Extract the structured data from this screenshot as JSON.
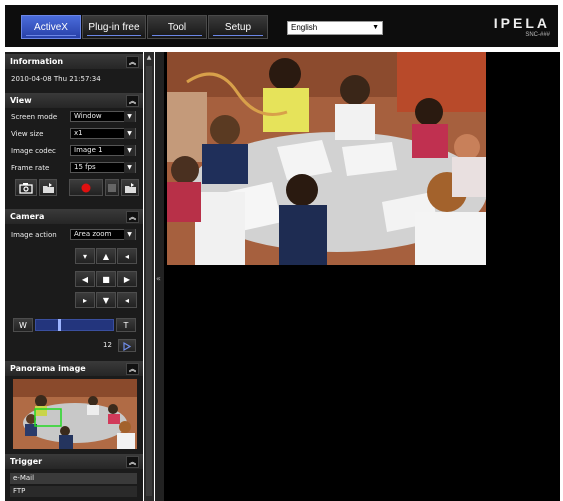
{
  "tabs": [
    {
      "label": "ActiveX",
      "active": true
    },
    {
      "label": "Plug-in free",
      "active": false
    },
    {
      "label": "Tool",
      "active": false
    },
    {
      "label": "Setup",
      "active": false
    }
  ],
  "language": {
    "selected": "English"
  },
  "logo": {
    "brand": "IPELA",
    "model": "SNC-###"
  },
  "information": {
    "title": "Information",
    "datetime": "2010-04-08 Thu 21:57:34"
  },
  "view": {
    "title": "View",
    "screen_mode": {
      "label": "Screen mode",
      "value": "Window"
    },
    "view_size": {
      "label": "View size",
      "value": "x1"
    },
    "image_codec": {
      "label": "Image codec",
      "value": "Image 1"
    },
    "frame_rate": {
      "label": "Frame rate",
      "value": "15 fps"
    }
  },
  "camera": {
    "title": "Camera",
    "image_action": {
      "label": "Image action",
      "value": "Area zoom"
    },
    "zoom_wide": "W",
    "zoom_tele": "T",
    "zoom_level_fraction": 0.3,
    "zoom_value": "12"
  },
  "panorama": {
    "title": "Panorama image"
  },
  "trigger": {
    "title": "Trigger",
    "items": [
      "e-Mail",
      "FTP"
    ]
  },
  "colors": {
    "accent": "#2f4fc0",
    "record": "#e01010",
    "panel": "#1b1b1b"
  }
}
